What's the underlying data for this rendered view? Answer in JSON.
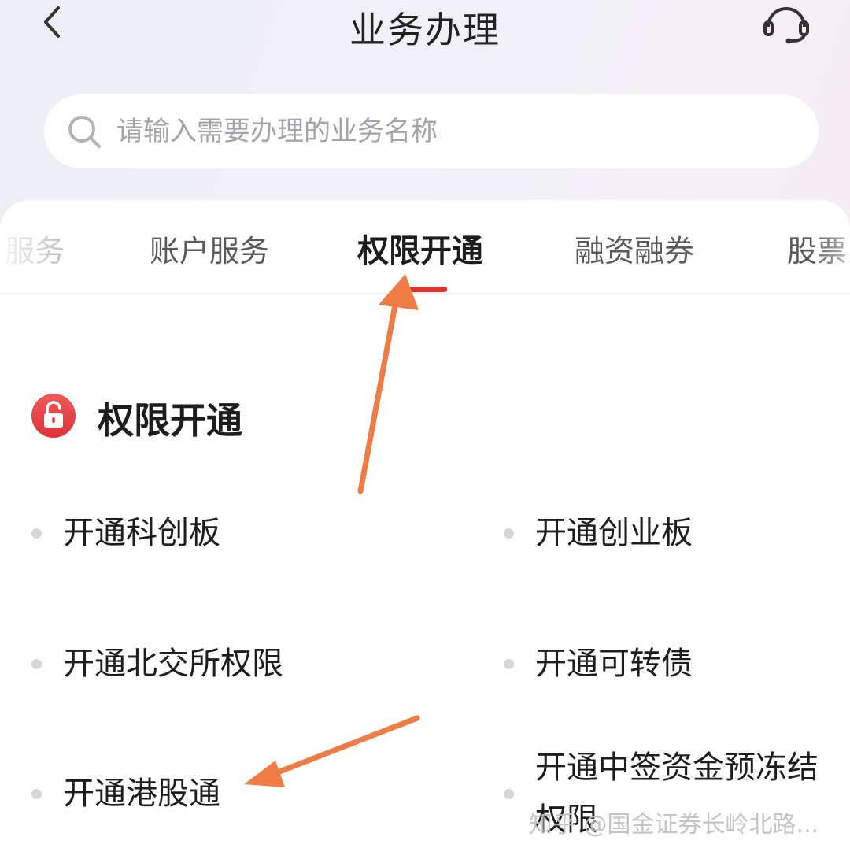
{
  "header": {
    "title": "业务办理",
    "back_icon": "chevron-left-icon",
    "service_icon": "headset-icon"
  },
  "search": {
    "placeholder": "请输入需要办理的业务名称",
    "icon": "search-icon"
  },
  "tabs": [
    {
      "label": "服务",
      "active": false
    },
    {
      "label": "账户服务",
      "active": false
    },
    {
      "label": "权限开通",
      "active": true
    },
    {
      "label": "融资融券",
      "active": false
    },
    {
      "label": "股票",
      "active": false
    }
  ],
  "section": {
    "title": "权限开通",
    "icon": "unlock-icon"
  },
  "items": [
    {
      "label": "开通科创板"
    },
    {
      "label": "开通创业板"
    },
    {
      "label": "开通北交所权限"
    },
    {
      "label": "开通可转债"
    },
    {
      "label": "开通港股通"
    },
    {
      "label": "开通中签资金预冻结权限"
    }
  ],
  "watermark": "知乎 @国金证券长岭北路...",
  "colors": {
    "accent": "#e0302f",
    "annotation_arrow": "#f07c45",
    "lock_icon_bg": "#e8474a"
  }
}
